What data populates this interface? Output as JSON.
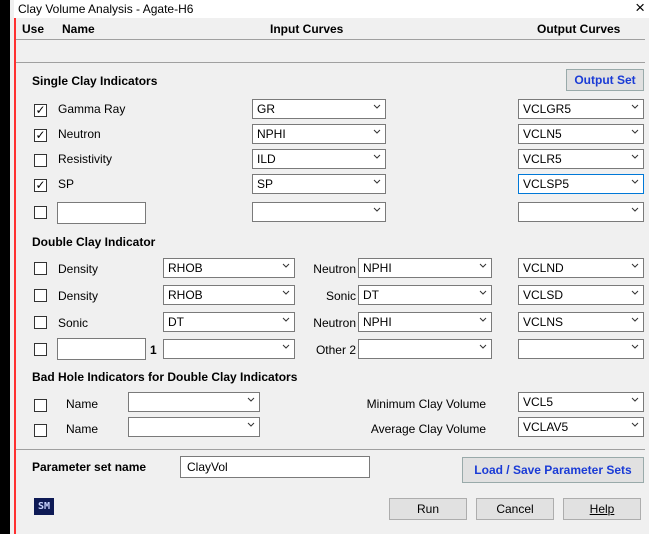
{
  "window": {
    "title": "Clay Volume Analysis - Agate-H6",
    "close_symbol": "×"
  },
  "header": {
    "use": "Use",
    "name": "Name",
    "input_curves": "Input Curves",
    "output_curves": "Output Curves"
  },
  "single": {
    "title": "Single Clay Indicators",
    "output_set_button": "Output Set",
    "rows": [
      {
        "checked": true,
        "name": "Gamma Ray",
        "input": "GR",
        "output": "VCLGR5"
      },
      {
        "checked": true,
        "name": "Neutron",
        "input": "NPHI",
        "output": "VCLN5"
      },
      {
        "checked": false,
        "name": "Resistivity",
        "input": "ILD",
        "output": "VCLR5"
      },
      {
        "checked": true,
        "name": "SP",
        "input": "SP",
        "output": "VCLSP5"
      },
      {
        "checked": false,
        "name": "",
        "input": "",
        "output": ""
      }
    ]
  },
  "double": {
    "title": "Double Clay Indicator",
    "rows": [
      {
        "checked": false,
        "name1": "Density",
        "input1": "RHOB",
        "name2": "Neutron",
        "input2": "NPHI",
        "output": "VCLND"
      },
      {
        "checked": false,
        "name1": "Density",
        "input1": "RHOB",
        "name2": "Sonic",
        "input2": "DT",
        "output": "VCLSD"
      },
      {
        "checked": false,
        "name1": "Sonic",
        "input1": "DT",
        "name2": "Neutron",
        "input2": "NPHI",
        "output": "VCLNS"
      },
      {
        "checked": false,
        "name1": "",
        "exponent": "1",
        "input1": "",
        "name2": "Other 2",
        "input2": "",
        "output": ""
      }
    ]
  },
  "badhole": {
    "title": "Bad Hole Indicators for Double Clay Indicators",
    "rows": [
      {
        "checked": false,
        "name_label": "Name",
        "value": "",
        "label": "Minimum Clay Volume",
        "output": "VCL5"
      },
      {
        "checked": false,
        "name_label": "Name",
        "value": "",
        "label": "Average Clay Volume",
        "output": "VCLAV5"
      }
    ]
  },
  "params": {
    "label": "Parameter set name",
    "value": "ClayVol",
    "load_save_button": "Load / Save Parameter Sets"
  },
  "footer": {
    "logo": "SM",
    "run": "Run",
    "cancel": "Cancel",
    "help": "Help"
  },
  "colors": {
    "accent_blue": "#1a3bd6",
    "focus_border": "#0078d7",
    "left_marker": "#ff3030"
  }
}
